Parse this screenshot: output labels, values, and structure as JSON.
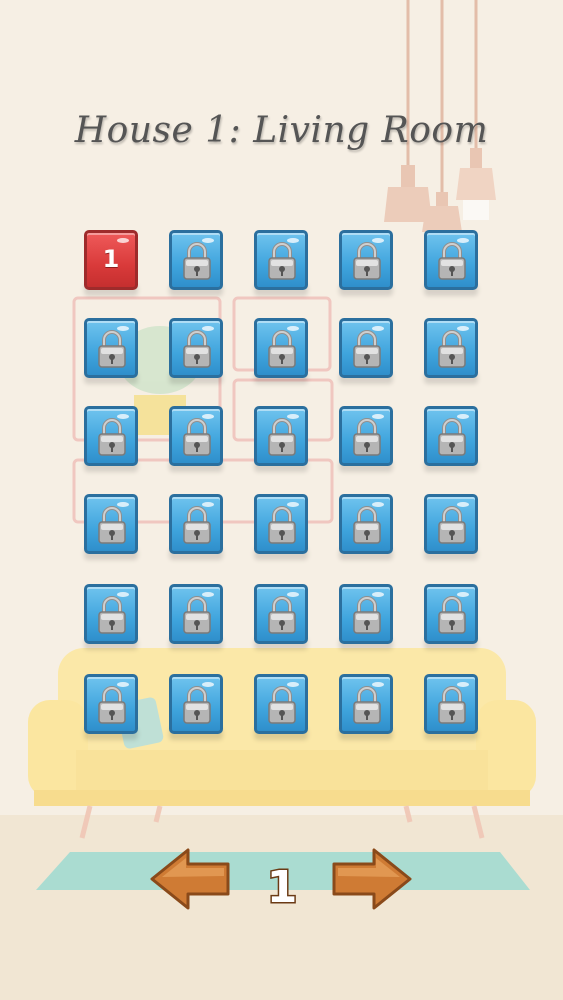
{
  "title": "House 1: Living Room",
  "pager": {
    "current_page": "1"
  },
  "levels": [
    {
      "label": "1",
      "state": "unlocked"
    },
    {
      "label": "",
      "state": "locked"
    },
    {
      "label": "",
      "state": "locked"
    },
    {
      "label": "",
      "state": "locked"
    },
    {
      "label": "",
      "state": "locked"
    },
    {
      "label": "",
      "state": "locked"
    },
    {
      "label": "",
      "state": "locked"
    },
    {
      "label": "",
      "state": "locked"
    },
    {
      "label": "",
      "state": "locked"
    },
    {
      "label": "",
      "state": "locked"
    },
    {
      "label": "",
      "state": "locked"
    },
    {
      "label": "",
      "state": "locked"
    },
    {
      "label": "",
      "state": "locked"
    },
    {
      "label": "",
      "state": "locked"
    },
    {
      "label": "",
      "state": "locked"
    },
    {
      "label": "",
      "state": "locked"
    },
    {
      "label": "",
      "state": "locked"
    },
    {
      "label": "",
      "state": "locked"
    },
    {
      "label": "",
      "state": "locked"
    },
    {
      "label": "",
      "state": "locked"
    },
    {
      "label": "",
      "state": "locked"
    },
    {
      "label": "",
      "state": "locked"
    },
    {
      "label": "",
      "state": "locked"
    },
    {
      "label": "",
      "state": "locked"
    },
    {
      "label": "",
      "state": "locked"
    },
    {
      "label": "",
      "state": "locked"
    },
    {
      "label": "",
      "state": "locked"
    },
    {
      "label": "",
      "state": "locked"
    },
    {
      "label": "",
      "state": "locked"
    },
    {
      "label": "",
      "state": "locked"
    }
  ],
  "colors": {
    "background": "#f6efe4",
    "tile_locked": "#3fa4dd",
    "tile_unlocked": "#d93a3a",
    "arrow_wood": "#c8742f",
    "sofa": "#fae7a6",
    "rug": "#a9dcd1"
  },
  "icons": {
    "lock": "padlock-icon",
    "prev": "arrow-left-icon",
    "next": "arrow-right-icon"
  }
}
